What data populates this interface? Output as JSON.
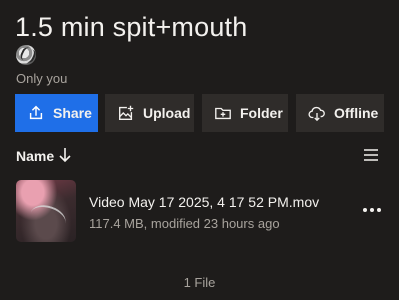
{
  "folder": {
    "title": "1.5 min spit+mouth",
    "sharing_status": "Only you",
    "owner_avatar": "owner-avatar"
  },
  "actions": [
    {
      "label": "Share",
      "icon": "share-upload-icon",
      "primary": true
    },
    {
      "label": "Upload",
      "icon": "upload-image-icon",
      "primary": false
    },
    {
      "label": "Folder",
      "icon": "new-folder-icon",
      "primary": false
    },
    {
      "label": "Offline",
      "icon": "cloud-download-icon",
      "primary": false
    }
  ],
  "list": {
    "sort_label": "Name",
    "sort_direction": "descending",
    "view_toggle_icon": "list-view-icon"
  },
  "files": [
    {
      "name": "Video May 17 2025, 4 17 52 PM.mov",
      "meta": "117.4 MB, modified 23 hours ago",
      "type": "video"
    }
  ],
  "footer": {
    "count_label": "1 File"
  },
  "colors": {
    "background": "#1e1c1b",
    "primary_button": "#1f6fe8",
    "secondary_button": "#2f2c2a",
    "text": "#f3f1ee",
    "muted_text": "#a8a39d"
  }
}
